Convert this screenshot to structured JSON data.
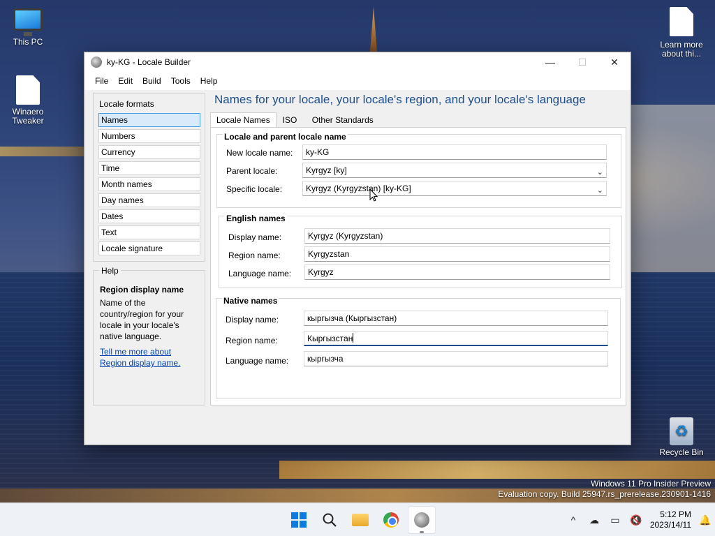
{
  "desktop": {
    "icons": [
      {
        "label": "This PC"
      },
      {
        "label": "Winaero Tweaker"
      },
      {
        "label": "Learn more about thi..."
      },
      {
        "label": "Recycle Bin"
      }
    ],
    "watermark": {
      "line1": "Windows 11 Pro Insider Preview",
      "line2": "Evaluation copy. Build 25947.rs_prerelease.230901-1416"
    }
  },
  "window": {
    "title": "ky-KG - Locale Builder",
    "controls": {
      "minimize": "—",
      "maximize": "☐",
      "close": "✕"
    },
    "menu": [
      "File",
      "Edit",
      "Build",
      "Tools",
      "Help"
    ]
  },
  "locale_formats": {
    "caption": "Locale formats",
    "items": [
      "Names",
      "Numbers",
      "Currency",
      "Time",
      "Month names",
      "Day names",
      "Dates",
      "Text",
      "Locale signature"
    ],
    "selected": "Names"
  },
  "help": {
    "caption": "Help",
    "title": "Region display name",
    "body": "Name of the country/region for your locale in your locale's native language.",
    "link": "Tell me more about Region display name."
  },
  "main": {
    "heading": "Names for your locale, your locale's region, and your locale's language",
    "tabs": [
      "Locale Names",
      "ISO",
      "Other Standards"
    ],
    "active_tab": "Locale Names",
    "locale_group": {
      "legend": "Locale and parent locale name",
      "new_locale_label": "New locale name:",
      "new_locale_value": "ky-KG",
      "parent_label": "Parent locale:",
      "parent_value": "Kyrgyz [ky]",
      "specific_label": "Specific locale:",
      "specific_value": "Kyrgyz (Kyrgyzstan) [ky-KG]"
    },
    "english_group": {
      "legend": "English names",
      "display_label": "Display name:",
      "display_value": "Kyrgyz (Kyrgyzstan)",
      "region_label": "Region name:",
      "region_value": "Kyrgyzstan",
      "language_label": "Language name:",
      "language_value": "Kyrgyz"
    },
    "native_group": {
      "legend": "Native names",
      "display_label": "Display name:",
      "display_value": "кыргызча (Кыргызстан)",
      "region_label": "Region name:",
      "region_value": "Кыргызстан",
      "language_label": "Language name:",
      "language_value": "кыргызча"
    }
  },
  "taskbar": {
    "apps": [
      "start-icon",
      "search-icon",
      "file-explorer-icon",
      "chrome-icon",
      "locale-builder-icon"
    ],
    "tray": {
      "chevron": "^",
      "time": "5:12 PM",
      "date": "2023/14/11"
    }
  }
}
